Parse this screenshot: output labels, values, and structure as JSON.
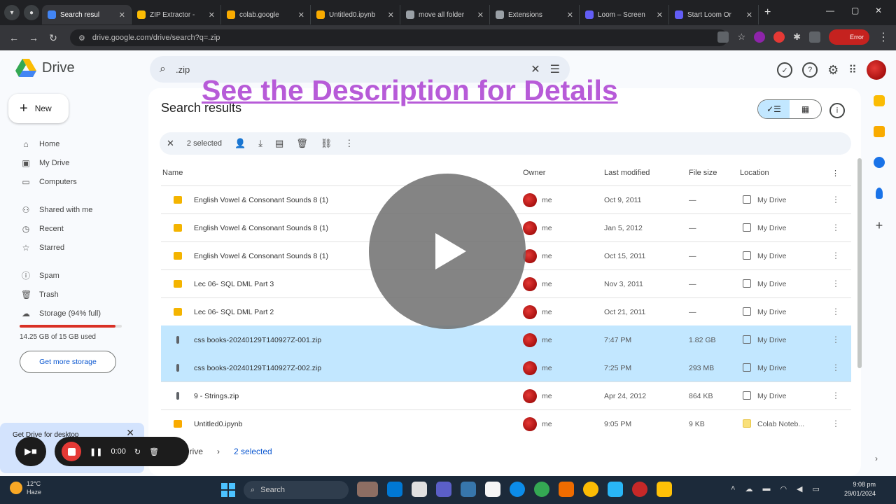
{
  "browser": {
    "tabs": [
      {
        "title": "Search resul",
        "active": true,
        "color": "#4285f4"
      },
      {
        "title": "ZIP Extractor -",
        "color": "#fbbc04"
      },
      {
        "title": "colab.google",
        "color": "#f9ab00"
      },
      {
        "title": "Untitled0.ipynb",
        "color": "#f9ab00"
      },
      {
        "title": "move all folder",
        "color": "#9aa0a6"
      },
      {
        "title": "Extensions",
        "color": "#9aa0a6"
      },
      {
        "title": "Loom – Screen",
        "color": "#625df5"
      },
      {
        "title": "Start Loom Or",
        "color": "#625df5"
      }
    ],
    "url": "drive.google.com/drive/search?q=.zip",
    "profile_label": "Error"
  },
  "drive": {
    "app_name": "Drive",
    "search_query": ".zip",
    "overlay_title": "See the Description for Details",
    "new_label": "New",
    "sidebar": [
      {
        "label": "Home",
        "icon": "home-icon",
        "glyph": "⌂"
      },
      {
        "label": "My Drive",
        "icon": "my-drive-icon",
        "glyph": "▣"
      },
      {
        "label": "Computers",
        "icon": "computer-icon",
        "glyph": "▭"
      },
      {
        "label": "Shared with me",
        "icon": "shared-icon",
        "glyph": "⚇",
        "gap": true
      },
      {
        "label": "Recent",
        "icon": "clock-icon",
        "glyph": "◷"
      },
      {
        "label": "Starred",
        "icon": "star-icon",
        "glyph": "☆"
      },
      {
        "label": "Spam",
        "icon": "spam-icon",
        "glyph": "ⓘ",
        "gap": true
      },
      {
        "label": "Trash",
        "icon": "trash-icon",
        "glyph": "🗑"
      },
      {
        "label": "Storage (94% full)",
        "icon": "cloud-icon",
        "glyph": "☁"
      }
    ],
    "storage": {
      "used_text": "14.25 GB of 15 GB used",
      "percent": 94,
      "button": "Get more storage"
    },
    "promo_text": "Get Drive for desktop",
    "heading": "Search results",
    "selection": {
      "count_label": "2 selected"
    },
    "columns": {
      "name": "Name",
      "owner": "Owner",
      "modified": "Last modified",
      "size": "File size",
      "location": "Location"
    },
    "files": [
      {
        "name": "English Vowel & Consonant Sounds 8 (1)",
        "owner": "me",
        "modified": "Oct 9, 2011",
        "size": "—",
        "location": "My Drive",
        "type": "slides",
        "selected": false
      },
      {
        "name": "English Vowel & Consonant Sounds 8 (1)",
        "owner": "me",
        "modified": "Jan 5, 2012",
        "size": "—",
        "location": "My Drive",
        "type": "slides",
        "selected": false
      },
      {
        "name": "English Vowel & Consonant Sounds 8 (1)",
        "owner": "me",
        "modified": "Oct 15, 2011",
        "size": "—",
        "location": "My Drive",
        "type": "slides",
        "selected": false
      },
      {
        "name": "Lec 06- SQL DML Part 3",
        "owner": "me",
        "modified": "Nov 3, 2011",
        "size": "—",
        "location": "My Drive",
        "type": "slides",
        "selected": false
      },
      {
        "name": "Lec 06- SQL DML Part 2",
        "owner": "me",
        "modified": "Oct 21, 2011",
        "size": "—",
        "location": "My Drive",
        "type": "slides",
        "selected": false
      },
      {
        "name": "css books-20240129T140927Z-001.zip",
        "owner": "me",
        "modified": "7:47 PM",
        "size": "1.82 GB",
        "location": "My Drive",
        "type": "zip",
        "selected": true
      },
      {
        "name": "css books-20240129T140927Z-002.zip",
        "owner": "me",
        "modified": "7:25 PM",
        "size": "293 MB",
        "location": "My Drive",
        "type": "zip",
        "selected": true
      },
      {
        "name": "9 - Strings.zip",
        "owner": "me",
        "modified": "Apr 24, 2012",
        "size": "864 KB",
        "location": "My Drive",
        "type": "zip",
        "selected": false
      },
      {
        "name": "Untitled0.ipynb",
        "owner": "me",
        "modified": "9:05 PM",
        "size": "9 KB",
        "location": "Colab Noteb...",
        "type": "notebook",
        "selected": false
      }
    ],
    "breadcrumb": {
      "root": "Drive",
      "current": "2 selected"
    }
  },
  "recorder": {
    "time": "0:00"
  },
  "taskbar": {
    "weather_temp": "12°C",
    "weather_desc": "Haze",
    "search_label": "Search",
    "time": "9:08 pm",
    "date": "29/01/2024"
  },
  "colors": {
    "slides": "#f4b400",
    "zip": "#5f6368",
    "notebook": "#f9ab00",
    "selected_row": "#c2e7ff",
    "overlay_title": "#b75bd8"
  }
}
